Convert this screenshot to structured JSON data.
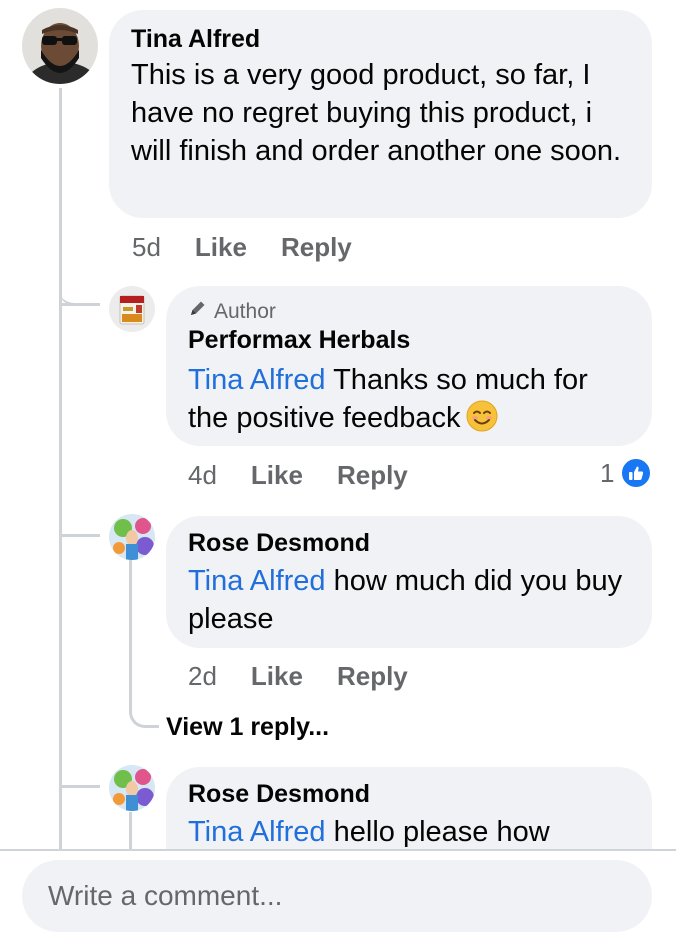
{
  "comments": [
    {
      "author": "Tina Alfred",
      "text": "This is a very good product, so far, I have no regret buying this product, i will finish and order another one soon.",
      "time": "5d",
      "like_label": "Like",
      "reply_label": "Reply"
    }
  ],
  "replies": [
    {
      "author_tag": "Author",
      "author": "Performax Herbals",
      "mention": "Tina Alfred",
      "text": " Thanks so much for the positive feedback",
      "emoji": "smiling-face",
      "time": "4d",
      "like_label": "Like",
      "reply_label": "Reply",
      "reaction_count": "1"
    },
    {
      "author": "Rose Desmond",
      "mention": "Tina Alfred",
      "text": " how much did you buy please",
      "time": "2d",
      "like_label": "Like",
      "reply_label": "Reply",
      "view_replies": "View 1 reply..."
    },
    {
      "author": "Rose Desmond",
      "mention": "Tina Alfred",
      "text": " hello please how"
    }
  ],
  "composer": {
    "placeholder": "Write a comment..."
  },
  "colors": {
    "mention": "#216fdb",
    "bubble": "#f0f2f5",
    "meta": "#65676b",
    "like_badge": "#1877f2"
  }
}
